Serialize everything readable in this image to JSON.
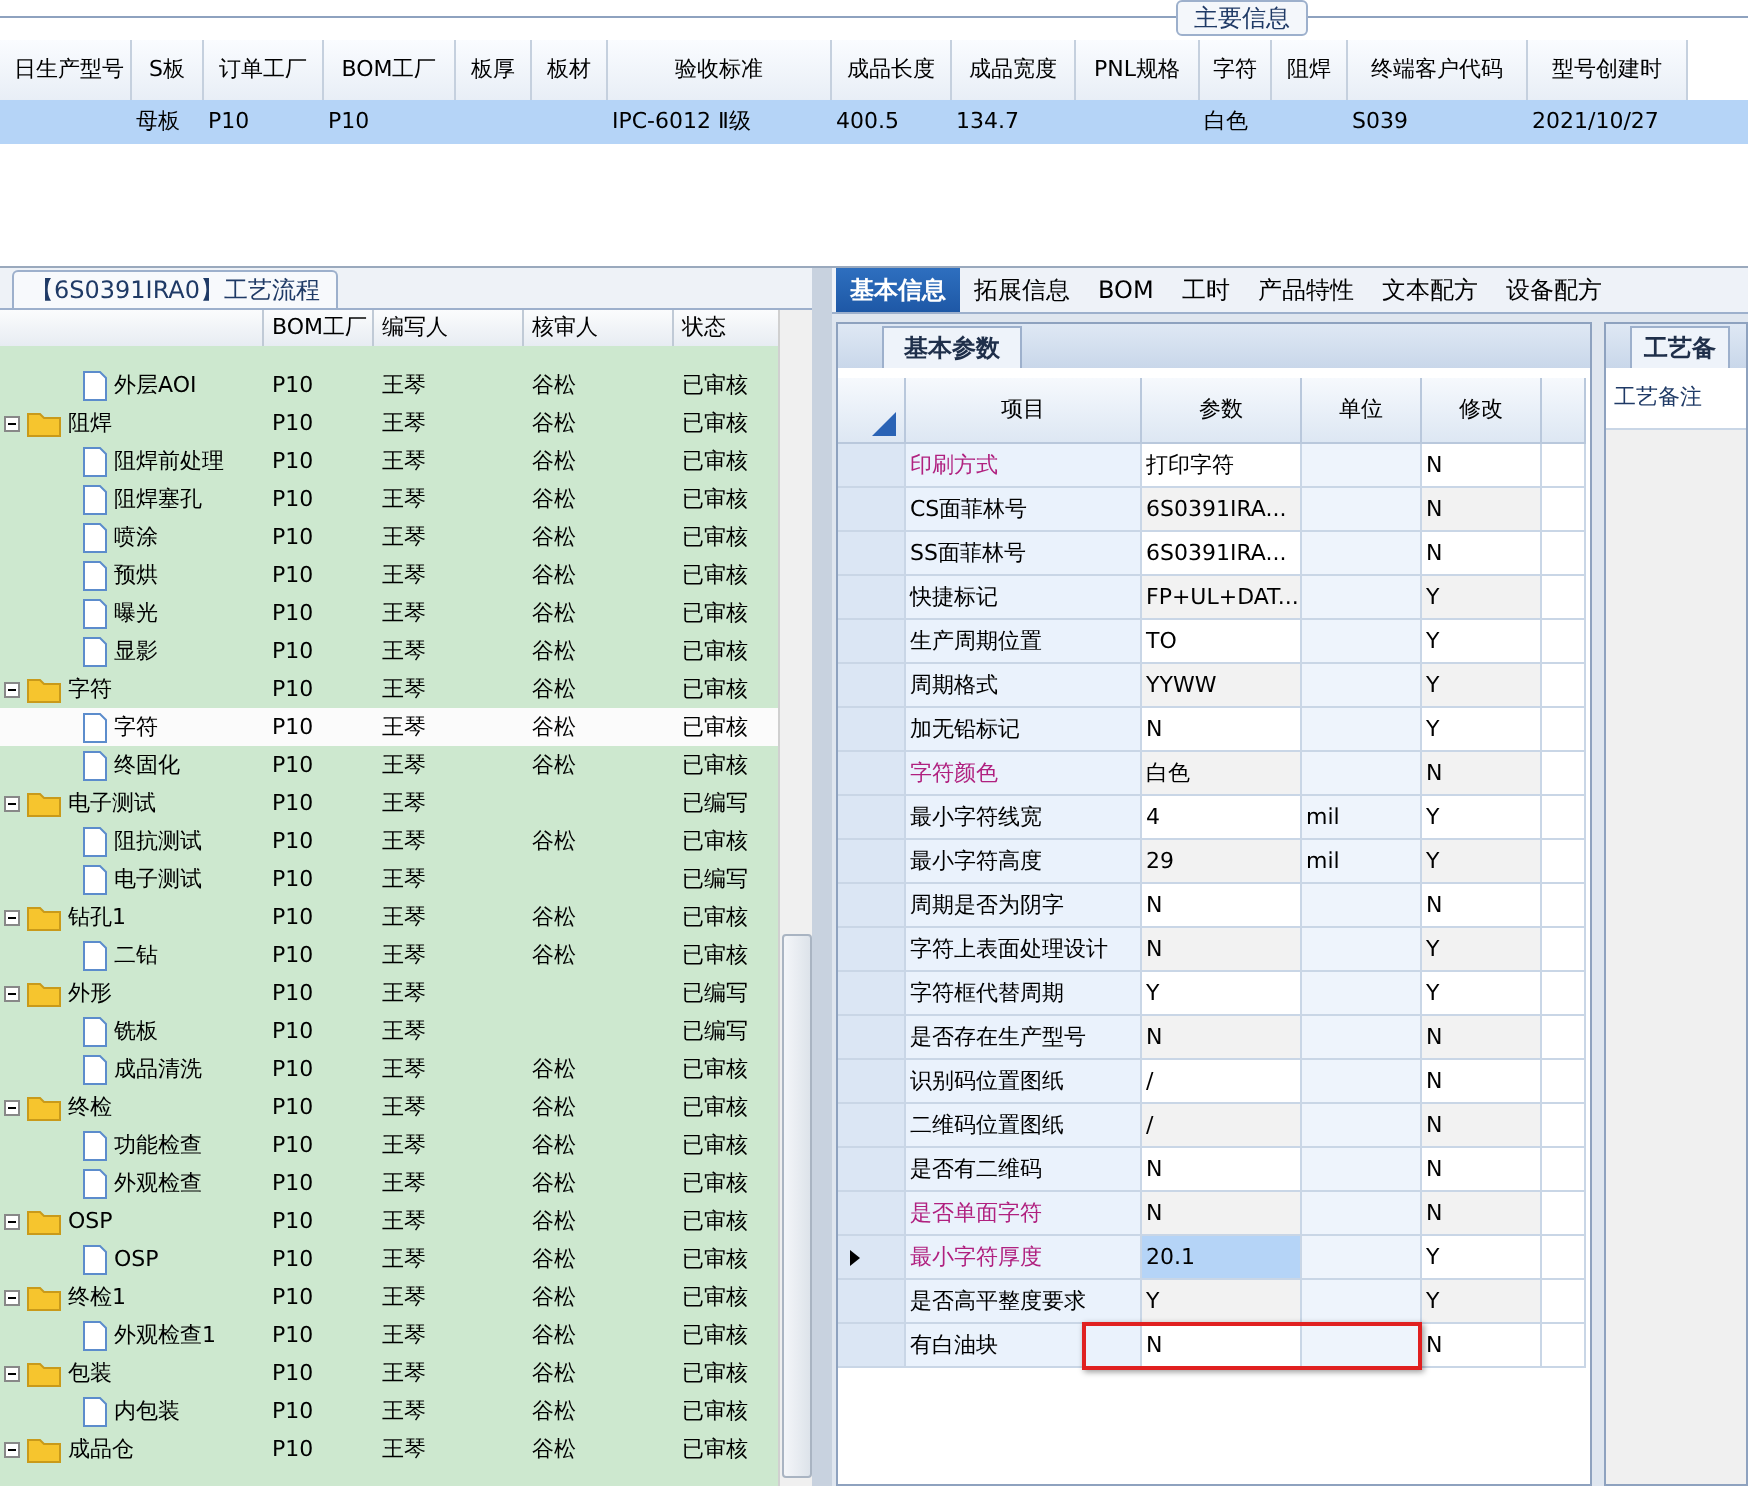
{
  "main_info": {
    "title": "主要信息",
    "columns": [
      "日生产型号",
      "S板",
      "订单工厂",
      "BOM工厂",
      "板厚",
      "板材",
      "验收标准",
      "成品长度",
      "成品宽度",
      "PNL规格",
      "字符",
      "阻焊",
      "终端客户代码",
      "型号创建时"
    ],
    "rows": [
      {
        "selected": true,
        "cells": [
          "",
          "母板",
          "P10",
          "P10",
          "",
          "",
          "IPC-6012 Ⅱ级",
          "400.5",
          "134.7",
          "",
          "白色",
          "",
          "S039",
          "2021/10/27"
        ]
      }
    ]
  },
  "process_flow": {
    "title": "【6S0391IRA0】工艺流程",
    "columns": [
      "BOM工厂",
      "编写人",
      "核审人",
      "状态"
    ],
    "tree": [
      {
        "children": [
          {
            "label": "外层AOI",
            "bom": "P10",
            "author": "王琴",
            "reviewer": "谷松",
            "status": "已审核",
            "selected": false
          }
        ]
      },
      {
        "label": "阻焊",
        "bom": "P10",
        "author": "王琴",
        "reviewer": "谷松",
        "status": "已审核",
        "selected": false,
        "expanded": true,
        "children": [
          {
            "label": "阻焊前处理",
            "bom": "P10",
            "author": "王琴",
            "reviewer": "谷松",
            "status": "已审核",
            "selected": false
          },
          {
            "label": "阻焊塞孔",
            "bom": "P10",
            "author": "王琴",
            "reviewer": "谷松",
            "status": "已审核",
            "selected": false
          },
          {
            "label": "喷涂",
            "bom": "P10",
            "author": "王琴",
            "reviewer": "谷松",
            "status": "已审核",
            "selected": false
          },
          {
            "label": "预烘",
            "bom": "P10",
            "author": "王琴",
            "reviewer": "谷松",
            "status": "已审核",
            "selected": false
          },
          {
            "label": "曝光",
            "bom": "P10",
            "author": "王琴",
            "reviewer": "谷松",
            "status": "已审核",
            "selected": false
          },
          {
            "label": "显影",
            "bom": "P10",
            "author": "王琴",
            "reviewer": "谷松",
            "status": "已审核",
            "selected": false
          }
        ]
      },
      {
        "label": "字符",
        "bom": "P10",
        "author": "王琴",
        "reviewer": "谷松",
        "status": "已审核",
        "selected": false,
        "expanded": true,
        "children": [
          {
            "label": "字符",
            "bom": "P10",
            "author": "王琴",
            "reviewer": "谷松",
            "status": "已审核",
            "selected": true
          },
          {
            "label": "终固化",
            "bom": "P10",
            "author": "王琴",
            "reviewer": "谷松",
            "status": "已审核",
            "selected": false
          }
        ]
      },
      {
        "label": "电子测试",
        "bom": "P10",
        "author": "王琴",
        "status": "已编写",
        "selected": false,
        "expanded": true,
        "children": [
          {
            "label": "阻抗测试",
            "bom": "P10",
            "author": "王琴",
            "reviewer": "谷松",
            "status": "已审核",
            "selected": false
          },
          {
            "label": "电子测试",
            "bom": "P10",
            "author": "王琴",
            "status": "已编写",
            "selected": false
          }
        ]
      },
      {
        "label": "钻孔1",
        "bom": "P10",
        "author": "王琴",
        "reviewer": "谷松",
        "status": "已审核",
        "selected": false,
        "expanded": true,
        "children": [
          {
            "label": "二钻",
            "bom": "P10",
            "author": "王琴",
            "reviewer": "谷松",
            "status": "已审核",
            "selected": false
          }
        ]
      },
      {
        "label": "外形",
        "bom": "P10",
        "author": "王琴",
        "status": "已编写",
        "selected": false,
        "expanded": true,
        "children": [
          {
            "label": "铣板",
            "bom": "P10",
            "author": "王琴",
            "status": "已编写",
            "selected": false
          },
          {
            "label": "成品清洗",
            "bom": "P10",
            "author": "王琴",
            "reviewer": "谷松",
            "status": "已审核",
            "selected": false
          }
        ]
      },
      {
        "label": "终检",
        "bom": "P10",
        "author": "王琴",
        "reviewer": "谷松",
        "status": "已审核",
        "selected": false,
        "expanded": true,
        "children": [
          {
            "label": "功能检查",
            "bom": "P10",
            "author": "王琴",
            "reviewer": "谷松",
            "status": "已审核",
            "selected": false
          },
          {
            "label": "外观检查",
            "bom": "P10",
            "author": "王琴",
            "reviewer": "谷松",
            "status": "已审核",
            "selected": false
          }
        ]
      },
      {
        "label": "OSP",
        "bom": "P10",
        "author": "王琴",
        "reviewer": "谷松",
        "status": "已审核",
        "selected": false,
        "expanded": true,
        "children": [
          {
            "label": "OSP",
            "bom": "P10",
            "author": "王琴",
            "reviewer": "谷松",
            "status": "已审核",
            "selected": false
          }
        ]
      },
      {
        "label": "终检1",
        "bom": "P10",
        "author": "王琴",
        "reviewer": "谷松",
        "status": "已审核",
        "selected": false,
        "expanded": true,
        "children": [
          {
            "label": "外观检查1",
            "bom": "P10",
            "author": "王琴",
            "reviewer": "谷松",
            "status": "已审核",
            "selected": false
          }
        ]
      },
      {
        "label": "包装",
        "bom": "P10",
        "author": "王琴",
        "reviewer": "谷松",
        "status": "已审核",
        "selected": false,
        "expanded": true,
        "children": [
          {
            "label": "内包装",
            "bom": "P10",
            "author": "王琴",
            "reviewer": "谷松",
            "status": "已审核",
            "selected": false
          }
        ]
      },
      {
        "label": "成品仓",
        "bom": "P10",
        "author": "王琴",
        "reviewer": "谷松",
        "status": "已审核",
        "selected": false,
        "expanded": true
      }
    ]
  },
  "detail_tabs": [
    {
      "label": "基本信息",
      "selected": true
    },
    {
      "label": "拓展信息",
      "selected": false
    },
    {
      "label": "BOM",
      "selected": false
    },
    {
      "label": "工时",
      "selected": false
    },
    {
      "label": "产品特性",
      "selected": false
    },
    {
      "label": "文本配方",
      "selected": false
    },
    {
      "label": "设备配方",
      "selected": false
    }
  ],
  "basic_params": {
    "title": "基本参数",
    "columns": [
      "项目",
      "参数",
      "单位",
      "修改"
    ],
    "rows": [
      {
        "item": "印刷方式",
        "value": "打印字符",
        "unit": "",
        "modified": "N",
        "required": true,
        "selected": false,
        "boxed": false
      },
      {
        "item": "CS面菲林号",
        "value": "6S0391IRA...",
        "unit": "",
        "modified": "N",
        "required": false,
        "selected": false,
        "boxed": false
      },
      {
        "item": "SS面菲林号",
        "value": "6S0391IRA...",
        "unit": "",
        "modified": "N",
        "required": false,
        "selected": false,
        "boxed": false
      },
      {
        "item": "快捷标记",
        "value": "FP+UL+DAT...",
        "unit": "",
        "modified": "Y",
        "required": false,
        "selected": false,
        "boxed": false
      },
      {
        "item": "生产周期位置",
        "value": "TO",
        "unit": "",
        "modified": "Y",
        "required": false,
        "selected": false,
        "boxed": false
      },
      {
        "item": "周期格式",
        "value": "YYWW",
        "unit": "",
        "modified": "Y",
        "required": false,
        "selected": false,
        "boxed": false
      },
      {
        "item": "加无铅标记",
        "value": "N",
        "unit": "",
        "modified": "Y",
        "required": false,
        "selected": false,
        "boxed": false
      },
      {
        "item": "字符颜色",
        "value": "白色",
        "unit": "",
        "modified": "N",
        "required": true,
        "selected": false,
        "boxed": false
      },
      {
        "item": "最小字符线宽",
        "value": "4",
        "unit": "mil",
        "modified": "Y",
        "required": false,
        "selected": false,
        "boxed": false
      },
      {
        "item": "最小字符高度",
        "value": "29",
        "unit": "mil",
        "modified": "Y",
        "required": false,
        "selected": false,
        "boxed": false
      },
      {
        "item": "周期是否为阴字",
        "value": "N",
        "unit": "",
        "modified": "N",
        "required": false,
        "selected": false,
        "boxed": false
      },
      {
        "item": "字符上表面处理设计",
        "value": "N",
        "unit": "",
        "modified": "Y",
        "required": false,
        "selected": false,
        "boxed": false
      },
      {
        "item": "字符框代替周期",
        "value": "Y",
        "unit": "",
        "modified": "Y",
        "required": false,
        "selected": false,
        "boxed": false
      },
      {
        "item": "是否存在生产型号",
        "value": "N",
        "unit": "",
        "modified": "N",
        "required": false,
        "selected": false,
        "boxed": false
      },
      {
        "item": "识别码位置图纸",
        "value": "/",
        "unit": "",
        "modified": "N",
        "required": false,
        "selected": false,
        "boxed": false
      },
      {
        "item": "二维码位置图纸",
        "value": "/",
        "unit": "",
        "modified": "N",
        "required": false,
        "selected": false,
        "boxed": false
      },
      {
        "item": "是否有二维码",
        "value": "N",
        "unit": "",
        "modified": "N",
        "required": false,
        "selected": false,
        "boxed": false
      },
      {
        "item": "是否单面字符",
        "value": "N",
        "unit": "",
        "modified": "N",
        "required": true,
        "selected": false,
        "boxed": false
      },
      {
        "item": "最小字符厚度",
        "value": "20.1",
        "unit": "",
        "modified": "Y",
        "required": true,
        "selected": true,
        "boxed": false
      },
      {
        "item": "是否高平整度要求",
        "value": "Y",
        "unit": "",
        "modified": "Y",
        "required": false,
        "selected": false,
        "boxed": false
      },
      {
        "item": "有白油块",
        "value": "N",
        "unit": "",
        "modified": "N",
        "required": false,
        "selected": false,
        "boxed": true
      }
    ]
  },
  "process_notes": {
    "title": "工艺备",
    "column": "工艺备注"
  }
}
